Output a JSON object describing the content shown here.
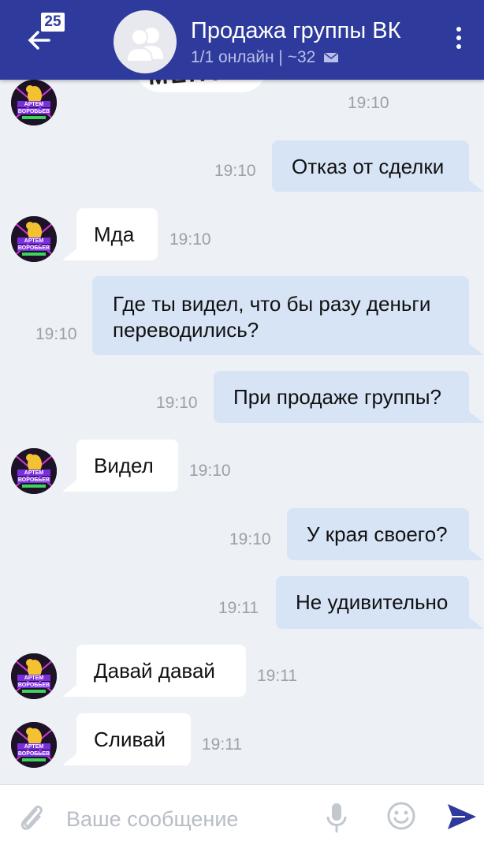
{
  "header": {
    "badge_count": "25",
    "title": "Продажа группы ВК",
    "status": "1/1 онлайн",
    "member_count": "~32"
  },
  "sticker_text": "МЕНТЫ",
  "messages": [
    {
      "direction": "in",
      "text": "",
      "time": "19:10"
    },
    {
      "direction": "out",
      "text": "Отказ от сделки",
      "time": "19:10"
    },
    {
      "direction": "in",
      "text": "Мда",
      "time": "19:10"
    },
    {
      "direction": "out",
      "lines": [
        "Где ты видел, что бы разу деньги",
        "переводились?"
      ],
      "time": "19:10"
    },
    {
      "direction": "out",
      "text": "При продаже группы?",
      "time": "19:10"
    },
    {
      "direction": "in",
      "text": "Видел",
      "time": "19:10"
    },
    {
      "direction": "out",
      "text": "У края своего?",
      "time": "19:10"
    },
    {
      "direction": "out",
      "text": "Не удивительно",
      "time": "19:11"
    },
    {
      "direction": "in",
      "text": "Давай давай",
      "time": "19:11"
    },
    {
      "direction": "in",
      "text": "Сливай",
      "time": "19:11"
    }
  ],
  "avatar_caption": [
    "АРТЕМ",
    "ВОРОБЬЕВ"
  ],
  "input": {
    "placeholder": "Ваше сообщение",
    "value": ""
  },
  "colors": {
    "header": "#2e3a9c",
    "outgoing": "#d7e4f6",
    "incoming": "#ffffff",
    "background": "#edf0f5",
    "send": "#2e3a9c"
  },
  "icons": [
    "back-arrow-icon",
    "group-avatar-icon",
    "mail-icon",
    "menu-dots-icon",
    "paperclip-icon",
    "mic-icon",
    "smile-icon",
    "send-icon"
  ]
}
